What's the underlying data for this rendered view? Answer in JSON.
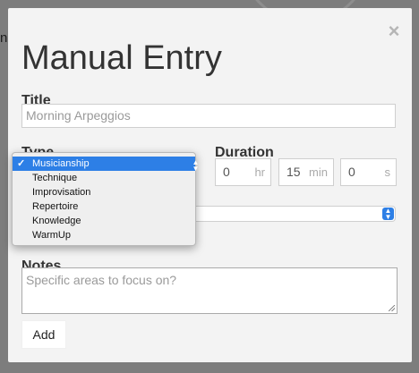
{
  "background": {
    "partial_text": "ne"
  },
  "modal": {
    "title": "Manual Entry",
    "close_glyph": "×",
    "title_label": "Title",
    "title_value": "Morning Arpeggios",
    "type_label": "Type",
    "duration_label": "Duration",
    "duration": {
      "hours": {
        "value": "0",
        "unit": "hr"
      },
      "minutes": {
        "value": "15",
        "unit": "min"
      },
      "seconds": {
        "value": "0",
        "unit": "s"
      }
    },
    "notes_label": "Notes",
    "notes_placeholder": "Specific areas to focus on?",
    "add_label": "Add"
  },
  "type_dropdown": {
    "check_glyph": "✓",
    "selected": "Musicianship",
    "options": [
      "Musicianship",
      "Technique",
      "Improvisation",
      "Repertoire",
      "Knowledge",
      "WarmUp"
    ]
  },
  "colors": {
    "accent": "#2d7fe6",
    "modal_bg": "#f3f3f3",
    "overlay": "#7d7d7d"
  },
  "icons": {
    "close": "close-icon",
    "checkmark": "checkmark-icon",
    "select_arrows": "chevron-up-down-icon"
  }
}
